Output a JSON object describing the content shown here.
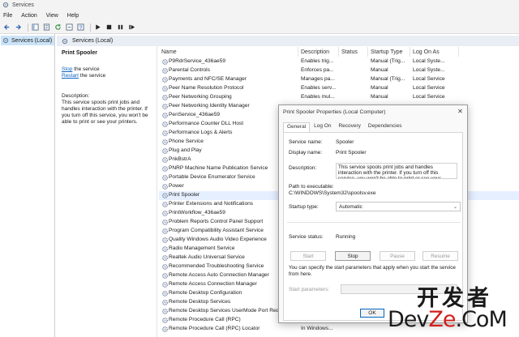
{
  "window": {
    "title": "Services"
  },
  "menu": [
    "File",
    "Action",
    "View",
    "Help"
  ],
  "tree": {
    "selected": "Services (Local)"
  },
  "panel": {
    "title": "Services (Local)"
  },
  "details": {
    "service_title": "Print Spooler",
    "stop_link": "Stop",
    "stop_rest": " the service",
    "restart_link": "Restart",
    "restart_rest": " the service",
    "description_label": "Description:",
    "description_text": "This service spools print jobs and handles interaction with the printer. If you turn off this service, you won't be able to print or see your printers."
  },
  "columns": [
    "Name",
    "Description",
    "Status",
    "Startup Type",
    "Log On As"
  ],
  "services": [
    {
      "name": "P9RdrService_436ae59",
      "description": "Enables trig...",
      "status": "",
      "startup": "Manual (Trig...",
      "logon": "Local Syste..."
    },
    {
      "name": "Parental Controls",
      "description": "Enforces pa...",
      "status": "",
      "startup": "Manual",
      "logon": "Local Syste..."
    },
    {
      "name": "Payments and NFC/SE Manager",
      "description": "Manages pa...",
      "status": "",
      "startup": "Manual (Trig...",
      "logon": "Local Service"
    },
    {
      "name": "Peer Name Resolution Protocol",
      "description": "Enables serv...",
      "status": "",
      "startup": "Manual",
      "logon": "Local Service"
    },
    {
      "name": "Peer Networking Grouping",
      "description": "Enables mul...",
      "status": "",
      "startup": "Manual",
      "logon": "Local Service"
    },
    {
      "name": "Peer Networking Identity Manager",
      "description": "",
      "status": "",
      "startup": "",
      "logon": ""
    },
    {
      "name": "PenService_436ae59",
      "description": "",
      "status": "",
      "startup": "",
      "logon": ""
    },
    {
      "name": "Performance Counter DLL Host",
      "description": "",
      "status": "",
      "startup": "",
      "logon": ""
    },
    {
      "name": "Performance Logs & Alerts",
      "description": "",
      "status": "",
      "startup": "",
      "logon": ""
    },
    {
      "name": "Phone Service",
      "description": "",
      "status": "",
      "startup": "",
      "logon": ""
    },
    {
      "name": "Plug and Play",
      "description": "",
      "status": "",
      "startup": "",
      "logon": ""
    },
    {
      "name": "PnkBstrA",
      "description": "",
      "status": "",
      "startup": "",
      "logon": ""
    },
    {
      "name": "PNRP Machine Name Publication Service",
      "description": "",
      "status": "",
      "startup": "",
      "logon": ""
    },
    {
      "name": "Portable Device Enumerator Service",
      "description": "",
      "status": "",
      "startup": "",
      "logon": ""
    },
    {
      "name": "Power",
      "description": "",
      "status": "",
      "startup": "",
      "logon": ""
    },
    {
      "name": "Print Spooler",
      "description": "",
      "status": "",
      "startup": "",
      "logon": ""
    },
    {
      "name": "Printer Extensions and Notifications",
      "description": "",
      "status": "",
      "startup": "",
      "logon": ""
    },
    {
      "name": "PrintWorkflow_436ae59",
      "description": "",
      "status": "",
      "startup": "",
      "logon": ""
    },
    {
      "name": "Problem Reports Control Panel Support",
      "description": "",
      "status": "",
      "startup": "",
      "logon": ""
    },
    {
      "name": "Program Compatibility Assistant Service",
      "description": "",
      "status": "",
      "startup": "",
      "logon": ""
    },
    {
      "name": "Quality Windows Audio Video Experience",
      "description": "",
      "status": "",
      "startup": "",
      "logon": ""
    },
    {
      "name": "Radio Management Service",
      "description": "",
      "status": "",
      "startup": "",
      "logon": ""
    },
    {
      "name": "Realtek Audio Universal Service",
      "description": "",
      "status": "",
      "startup": "",
      "logon": ""
    },
    {
      "name": "Recommended Troubleshooting Service",
      "description": "",
      "status": "",
      "startup": "",
      "logon": ""
    },
    {
      "name": "Remote Access Auto Connection Manager",
      "description": "",
      "status": "",
      "startup": "",
      "logon": ""
    },
    {
      "name": "Remote Access Connection Manager",
      "description": "",
      "status": "",
      "startup": "",
      "logon": ""
    },
    {
      "name": "Remote Desktop Configuration",
      "description": "",
      "status": "",
      "startup": "",
      "logon": ""
    },
    {
      "name": "Remote Desktop Services",
      "description": "",
      "status": "",
      "startup": "",
      "logon": ""
    },
    {
      "name": "Remote Desktop Services UserMode Port Redirector",
      "description": "",
      "status": "",
      "startup": "",
      "logon": ""
    },
    {
      "name": "Remote Procedure Call (RPC)",
      "description": "",
      "status": "",
      "startup": "",
      "logon": ""
    },
    {
      "name": "Remote Procedure Call (RPC) Locator",
      "description": "In Windows...",
      "status": "",
      "startup": "",
      "logon": ""
    }
  ],
  "selected_service": "Print Spooler",
  "dialog": {
    "title": "Print Spooler Properties (Local Computer)",
    "close_glyph": "✕",
    "tabs": [
      "General",
      "Log On",
      "Recovery",
      "Dependencies"
    ],
    "active_tab": "General",
    "service_name_label": "Service name:",
    "service_name": "Spooler",
    "display_name_label": "Display name:",
    "display_name": "Print Spooler",
    "description_label": "Description:",
    "description": "This service spools print jobs and handles interaction with the printer. If you turn off this service, you won't be able to print or see your printers.",
    "path_label": "Path to executable:",
    "path": "C:\\WINDOWS\\System32\\spoolsv.exe",
    "startup_type_label": "Startup type:",
    "startup_type": "Automatic",
    "service_status_label": "Service status:",
    "service_status": "Running",
    "buttons": {
      "start": "Start",
      "stop": "Stop",
      "pause": "Pause",
      "resume": "Resume"
    },
    "help_text": "You can specify the start parameters that apply when you start the service from here.",
    "start_params_label": "Start parameters:",
    "start_params_value": "",
    "ok": "OK"
  },
  "watermark": {
    "cn": "开发者",
    "en_prefix": "Dev",
    "en_red": "Ze",
    "en_suffix": ".CoM"
  },
  "colors": {
    "selection": "#cce4f7",
    "link": "#0b62c4",
    "accent": "#0067c0",
    "watermark_red": "#d0201c"
  }
}
